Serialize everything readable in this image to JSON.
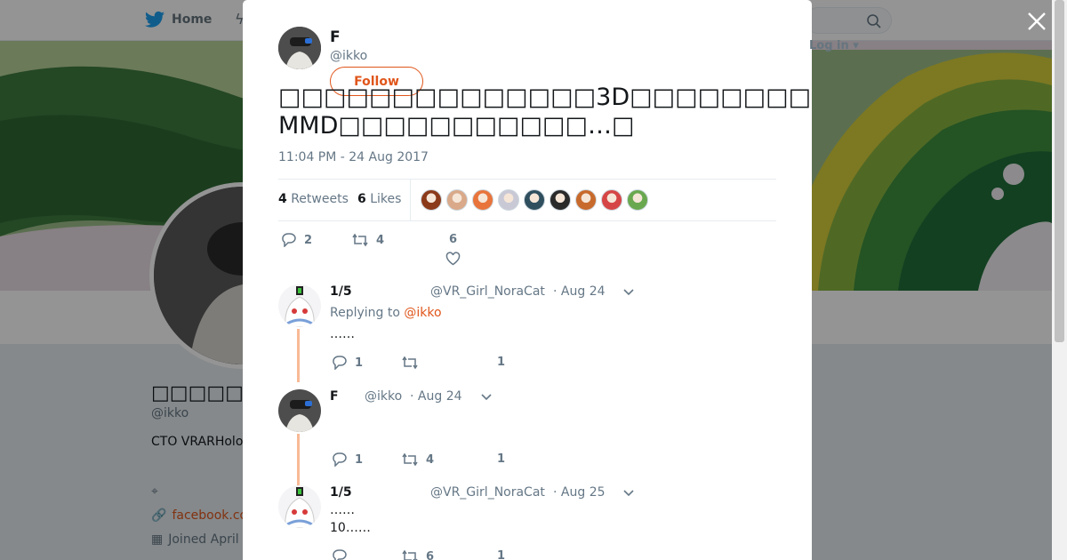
{
  "nav": {
    "home_label": "Home",
    "login_label": "Log in"
  },
  "profile": {
    "name": "□□□□□□□F",
    "handle": "@ikko",
    "bio": "CTO VRARHolo",
    "link": "facebook.co",
    "joined": "Joined April"
  },
  "tweet": {
    "author_name": "F",
    "author_handle": "@ikko",
    "follow_label": "Follow",
    "text": "□□□□□□□□□□□□□□3D□□□□□□□□□□□□□ MMD□□□□□□□□□□□…□",
    "timestamp": "11:04 PM - 24 Aug 2017",
    "retweets_count": "4",
    "retweets_label": "Retweets",
    "likes_count": "6",
    "likes_label": "Likes",
    "reply_count": "2",
    "retweet_action_count": "4",
    "like_action_count": "6"
  },
  "likers": [
    {
      "color": "#8b3a1a"
    },
    {
      "color": "#d9a98a"
    },
    {
      "color": "#e8743b"
    },
    {
      "color": "#c9c9d6"
    },
    {
      "color": "#2f4f5f"
    },
    {
      "color": "#2a2a2a"
    },
    {
      "color": "#c76a2c"
    },
    {
      "color": "#d64545"
    },
    {
      "color": "#6aa84f"
    }
  ],
  "replies": [
    {
      "name": "1/5",
      "handle": "@VR_Girl_NoraCat",
      "date": "· Aug 24",
      "replying_prefix": "Replying to",
      "replying_to": "@ikko",
      "text1": "……",
      "reply_count": "1",
      "retweet_count": "",
      "like_count": "1"
    },
    {
      "name": "F",
      "handle": "@ikko",
      "date": "· Aug 24",
      "reply_count": "1",
      "retweet_count": "4",
      "like_count": "1"
    },
    {
      "name": "1/5",
      "handle": "@VR_Girl_NoraCat",
      "date": "· Aug 25",
      "text1": "……",
      "text2": "10……",
      "reply_count": "",
      "retweet_count": "6",
      "like_count": "1"
    }
  ],
  "colors": {
    "accent": "#e0561b",
    "thread": "#f8b996",
    "twitter_blue": "#1da1f2"
  }
}
